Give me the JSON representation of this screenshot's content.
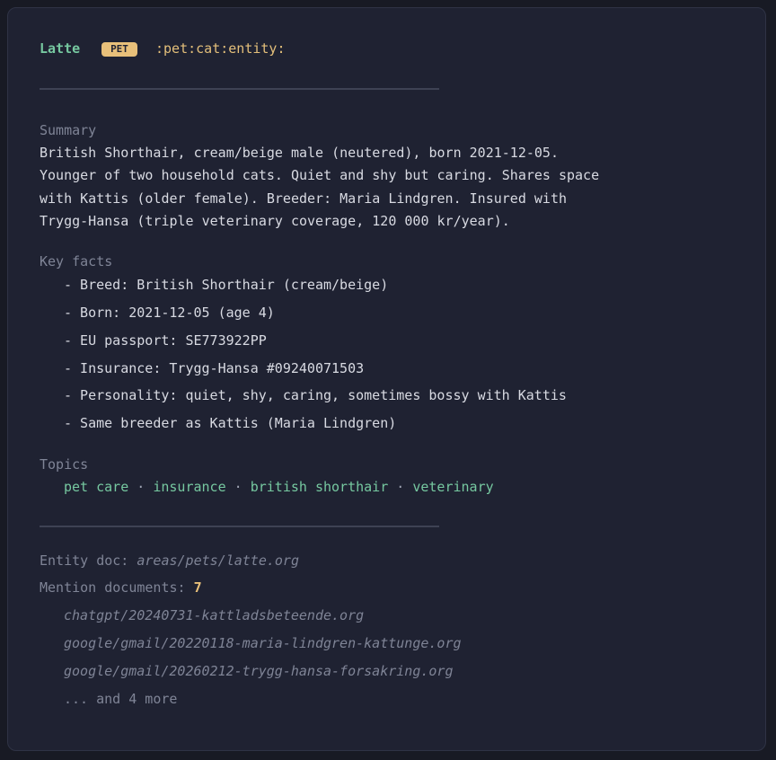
{
  "header": {
    "title": "Latte",
    "badge": "PET",
    "tags": ":pet:cat:entity:"
  },
  "summary": {
    "label": "Summary",
    "lines": [
      "British Shorthair, cream/beige male (neutered), born 2021-12-05.",
      "Younger of two household cats. Quiet and shy but caring. Shares space",
      "with Kattis (older female). Breeder: Maria Lindgren. Insured with",
      "Trygg-Hansa (triple veterinary coverage, 120 000 kr/year)."
    ]
  },
  "key_facts": {
    "label": "Key facts",
    "items": [
      "- Breed: British Shorthair (cream/beige)",
      "- Born: 2021-12-05 (age 4)",
      "- EU passport: SE773922PP",
      "- Insurance: Trygg-Hansa #09240071503",
      "- Personality: quiet, shy, caring, sometimes bossy with Kattis",
      "- Same breeder as Kattis (Maria Lindgren)"
    ]
  },
  "topics": {
    "label": "Topics",
    "items": [
      "pet care",
      "insurance",
      "british shorthair",
      "veterinary"
    ],
    "separator": " · "
  },
  "footer": {
    "entity_doc_label": "Entity doc:",
    "entity_doc_path": "areas/pets/latte.org",
    "mentions_label": "Mention documents:",
    "mentions_count": "7",
    "mentions": [
      "chatgpt/20240731-kattladsbeteende.org",
      "google/gmail/20220118-maria-lindgren-kattunge.org",
      "google/gmail/20260212-trygg-hansa-forsakring.org"
    ],
    "more": "... and 4 more"
  }
}
